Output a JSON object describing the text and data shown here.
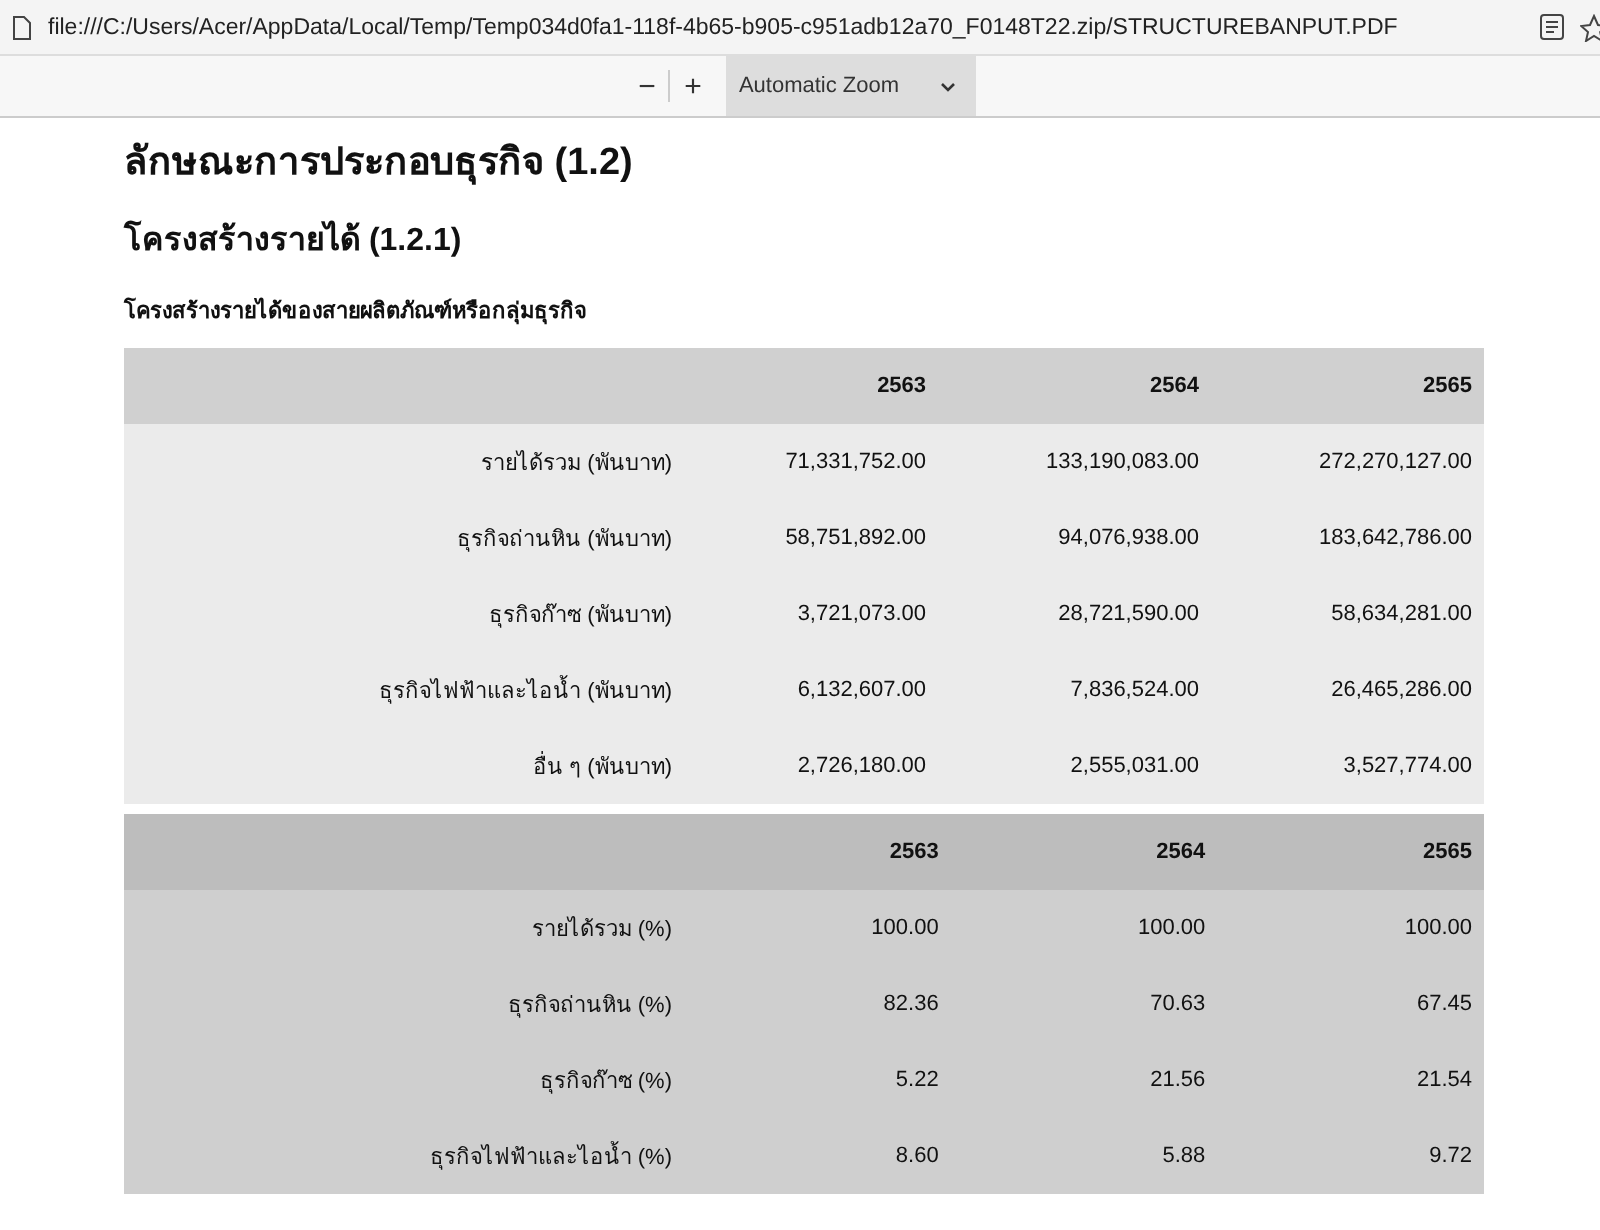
{
  "address_bar": {
    "url": "file:///C:/Users/Acer/AppData/Local/Temp/Temp034d0fa1-118f-4b65-b905-c951adb12a70_F0148T22.zip/STRUCTUREBANPUT.PDF"
  },
  "toolbar": {
    "zoom_out": "−",
    "zoom_in": "+",
    "zoom_select": "Automatic Zoom"
  },
  "document": {
    "heading": "ลักษณะการประกอบธุรกิจ (1.2)",
    "subheading": "โครงสร้างรายได้ (1.2.1)",
    "caption": "โครงสร้างรายได้ของสายผลิตภัณฑ์หรือกลุ่มธุรกิจ",
    "tables": [
      {
        "columns": [
          "2563",
          "2564",
          "2565"
        ],
        "rows": [
          {
            "label": "รายได้รวม (พันบาท)",
            "values": [
              "71,331,752.00",
              "133,190,083.00",
              "272,270,127.00"
            ]
          },
          {
            "label": "ธุรกิจถ่านหิน (พันบาท)",
            "values": [
              "58,751,892.00",
              "94,076,938.00",
              "183,642,786.00"
            ]
          },
          {
            "label": "ธุรกิจก๊าซ (พันบาท)",
            "values": [
              "3,721,073.00",
              "28,721,590.00",
              "58,634,281.00"
            ]
          },
          {
            "label": "ธุรกิจไฟฟ้าและไอน้ำ (พันบาท)",
            "values": [
              "6,132,607.00",
              "7,836,524.00",
              "26,465,286.00"
            ]
          },
          {
            "label": "อื่น ๆ (พันบาท)",
            "values": [
              "2,726,180.00",
              "2,555,031.00",
              "3,527,774.00"
            ]
          }
        ]
      },
      {
        "columns": [
          "2563",
          "2564",
          "2565"
        ],
        "rows": [
          {
            "label": "รายได้รวม (%)",
            "values": [
              "100.00",
              "100.00",
              "100.00"
            ]
          },
          {
            "label": "ธุรกิจถ่านหิน (%)",
            "values": [
              "82.36",
              "70.63",
              "67.45"
            ]
          },
          {
            "label": "ธุรกิจก๊าซ (%)",
            "values": [
              "5.22",
              "21.56",
              "21.54"
            ]
          },
          {
            "label": "ธุรกิจไฟฟ้าและไอน้ำ (%)",
            "values": [
              "8.60",
              "5.88",
              "9.72"
            ]
          }
        ]
      }
    ]
  }
}
